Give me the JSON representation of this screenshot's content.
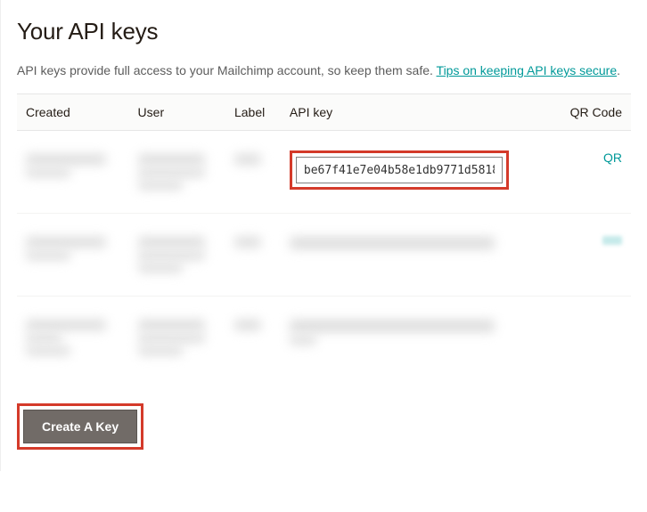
{
  "page": {
    "title": "Your API keys",
    "intro_pre": "API keys provide full access to your Mailchimp account, so keep them safe. ",
    "intro_link": "Tips on keeping API keys secure",
    "intro_post": "."
  },
  "table": {
    "headers": {
      "created": "Created",
      "user": "User",
      "label": "Label",
      "api_key": "API key",
      "qr": "QR Code"
    },
    "rows": [
      {
        "api_key": "be67f41e7e04b58e1db9771d5818",
        "qr_label": "QR",
        "highlighted": true
      },
      {
        "api_key": "",
        "qr_label": "",
        "highlighted": false
      },
      {
        "api_key": "",
        "qr_label": "",
        "highlighted": false
      }
    ]
  },
  "buttons": {
    "create": "Create A Key"
  }
}
